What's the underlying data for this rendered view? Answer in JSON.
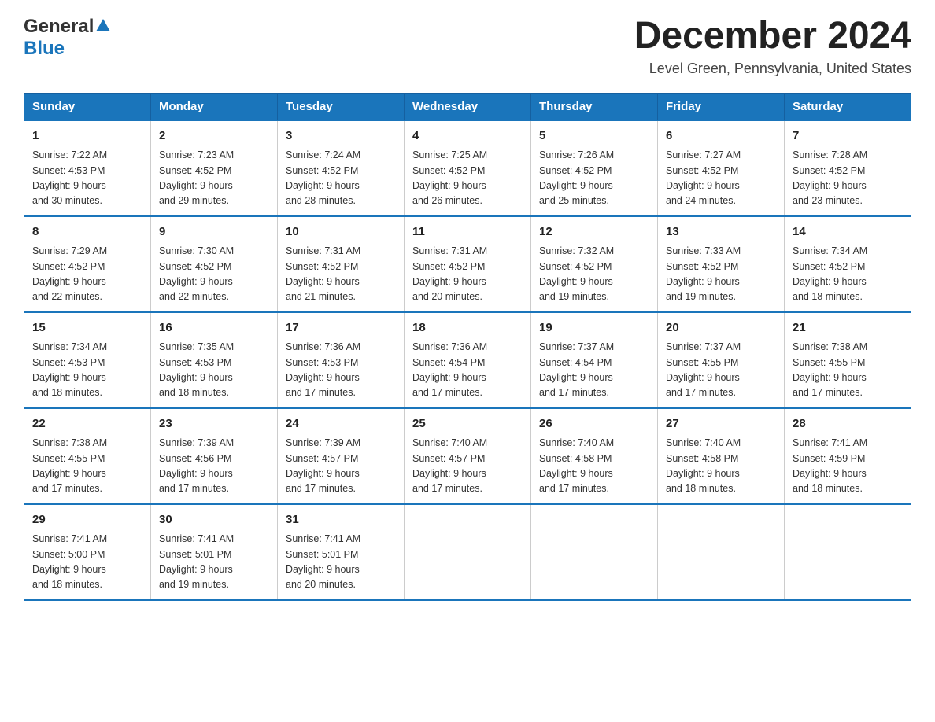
{
  "header": {
    "logo_general": "General",
    "logo_blue": "Blue",
    "month_title": "December 2024",
    "subtitle": "Level Green, Pennsylvania, United States"
  },
  "weekdays": [
    "Sunday",
    "Monday",
    "Tuesday",
    "Wednesday",
    "Thursday",
    "Friday",
    "Saturday"
  ],
  "weeks": [
    [
      {
        "day": "1",
        "sunrise": "7:22 AM",
        "sunset": "4:53 PM",
        "daylight": "9 hours and 30 minutes."
      },
      {
        "day": "2",
        "sunrise": "7:23 AM",
        "sunset": "4:52 PM",
        "daylight": "9 hours and 29 minutes."
      },
      {
        "day": "3",
        "sunrise": "7:24 AM",
        "sunset": "4:52 PM",
        "daylight": "9 hours and 28 minutes."
      },
      {
        "day": "4",
        "sunrise": "7:25 AM",
        "sunset": "4:52 PM",
        "daylight": "9 hours and 26 minutes."
      },
      {
        "day": "5",
        "sunrise": "7:26 AM",
        "sunset": "4:52 PM",
        "daylight": "9 hours and 25 minutes."
      },
      {
        "day": "6",
        "sunrise": "7:27 AM",
        "sunset": "4:52 PM",
        "daylight": "9 hours and 24 minutes."
      },
      {
        "day": "7",
        "sunrise": "7:28 AM",
        "sunset": "4:52 PM",
        "daylight": "9 hours and 23 minutes."
      }
    ],
    [
      {
        "day": "8",
        "sunrise": "7:29 AM",
        "sunset": "4:52 PM",
        "daylight": "9 hours and 22 minutes."
      },
      {
        "day": "9",
        "sunrise": "7:30 AM",
        "sunset": "4:52 PM",
        "daylight": "9 hours and 22 minutes."
      },
      {
        "day": "10",
        "sunrise": "7:31 AM",
        "sunset": "4:52 PM",
        "daylight": "9 hours and 21 minutes."
      },
      {
        "day": "11",
        "sunrise": "7:31 AM",
        "sunset": "4:52 PM",
        "daylight": "9 hours and 20 minutes."
      },
      {
        "day": "12",
        "sunrise": "7:32 AM",
        "sunset": "4:52 PM",
        "daylight": "9 hours and 19 minutes."
      },
      {
        "day": "13",
        "sunrise": "7:33 AM",
        "sunset": "4:52 PM",
        "daylight": "9 hours and 19 minutes."
      },
      {
        "day": "14",
        "sunrise": "7:34 AM",
        "sunset": "4:52 PM",
        "daylight": "9 hours and 18 minutes."
      }
    ],
    [
      {
        "day": "15",
        "sunrise": "7:34 AM",
        "sunset": "4:53 PM",
        "daylight": "9 hours and 18 minutes."
      },
      {
        "day": "16",
        "sunrise": "7:35 AM",
        "sunset": "4:53 PM",
        "daylight": "9 hours and 18 minutes."
      },
      {
        "day": "17",
        "sunrise": "7:36 AM",
        "sunset": "4:53 PM",
        "daylight": "9 hours and 17 minutes."
      },
      {
        "day": "18",
        "sunrise": "7:36 AM",
        "sunset": "4:54 PM",
        "daylight": "9 hours and 17 minutes."
      },
      {
        "day": "19",
        "sunrise": "7:37 AM",
        "sunset": "4:54 PM",
        "daylight": "9 hours and 17 minutes."
      },
      {
        "day": "20",
        "sunrise": "7:37 AM",
        "sunset": "4:55 PM",
        "daylight": "9 hours and 17 minutes."
      },
      {
        "day": "21",
        "sunrise": "7:38 AM",
        "sunset": "4:55 PM",
        "daylight": "9 hours and 17 minutes."
      }
    ],
    [
      {
        "day": "22",
        "sunrise": "7:38 AM",
        "sunset": "4:55 PM",
        "daylight": "9 hours and 17 minutes."
      },
      {
        "day": "23",
        "sunrise": "7:39 AM",
        "sunset": "4:56 PM",
        "daylight": "9 hours and 17 minutes."
      },
      {
        "day": "24",
        "sunrise": "7:39 AM",
        "sunset": "4:57 PM",
        "daylight": "9 hours and 17 minutes."
      },
      {
        "day": "25",
        "sunrise": "7:40 AM",
        "sunset": "4:57 PM",
        "daylight": "9 hours and 17 minutes."
      },
      {
        "day": "26",
        "sunrise": "7:40 AM",
        "sunset": "4:58 PM",
        "daylight": "9 hours and 17 minutes."
      },
      {
        "day": "27",
        "sunrise": "7:40 AM",
        "sunset": "4:58 PM",
        "daylight": "9 hours and 18 minutes."
      },
      {
        "day": "28",
        "sunrise": "7:41 AM",
        "sunset": "4:59 PM",
        "daylight": "9 hours and 18 minutes."
      }
    ],
    [
      {
        "day": "29",
        "sunrise": "7:41 AM",
        "sunset": "5:00 PM",
        "daylight": "9 hours and 18 minutes."
      },
      {
        "day": "30",
        "sunrise": "7:41 AM",
        "sunset": "5:01 PM",
        "daylight": "9 hours and 19 minutes."
      },
      {
        "day": "31",
        "sunrise": "7:41 AM",
        "sunset": "5:01 PM",
        "daylight": "9 hours and 20 minutes."
      },
      null,
      null,
      null,
      null
    ]
  ],
  "labels": {
    "sunrise": "Sunrise:",
    "sunset": "Sunset:",
    "daylight": "Daylight:"
  }
}
